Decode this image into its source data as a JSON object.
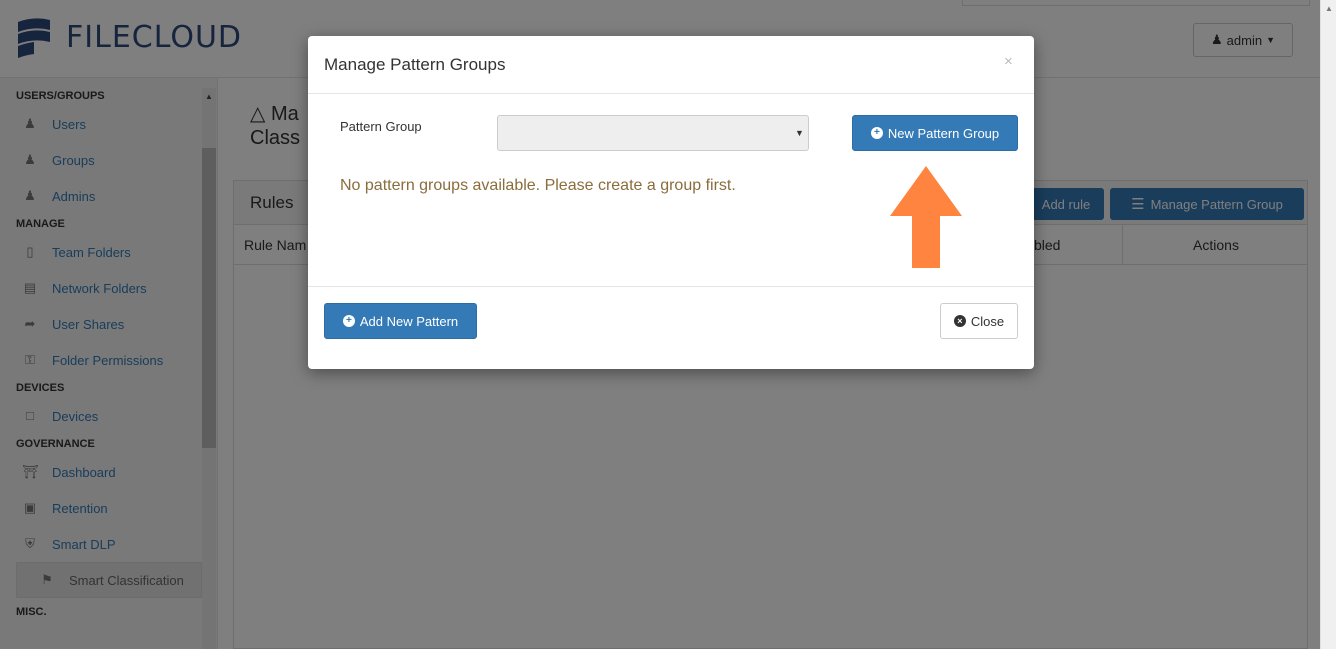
{
  "header": {
    "logo_text": "FILECLOUD",
    "user_menu_label": "admin"
  },
  "sidebar": {
    "sections": [
      {
        "title": "USERS/GROUPS",
        "items": [
          {
            "label": "Users",
            "icon": "user-icon"
          },
          {
            "label": "Groups",
            "icon": "users-icon"
          },
          {
            "label": "Admins",
            "icon": "admin-icon"
          }
        ]
      },
      {
        "title": "MANAGE",
        "items": [
          {
            "label": "Team Folders",
            "icon": "folder-open-icon"
          },
          {
            "label": "Network Folders",
            "icon": "hdd-icon"
          },
          {
            "label": "User Shares",
            "icon": "share-icon"
          },
          {
            "label": "Folder Permissions",
            "icon": "key-icon"
          }
        ]
      },
      {
        "title": "DEVICES",
        "items": [
          {
            "label": "Devices",
            "icon": "device-icon"
          }
        ]
      },
      {
        "title": "GOVERNANCE",
        "items": [
          {
            "label": "Dashboard",
            "icon": "bank-icon"
          },
          {
            "label": "Retention",
            "icon": "archive-icon"
          },
          {
            "label": "Smart DLP",
            "icon": "shield-icon"
          },
          {
            "label": "Smart Classification",
            "icon": "tags-icon"
          }
        ]
      },
      {
        "title": "MISC.",
        "items": []
      }
    ]
  },
  "main": {
    "page_title_line1": "Ma",
    "page_title_line2": "Class",
    "panel_title": "Rules",
    "add_rule_label": "Add rule",
    "manage_pattern_group_label": "Manage Pattern Group",
    "columns": {
      "rule_name": "Rule Nam",
      "enabled": "bled",
      "actions": "Actions"
    }
  },
  "modal": {
    "title": "Manage Pattern Groups",
    "close_x": "×",
    "pattern_group_label": "Pattern Group",
    "pattern_group_value": "",
    "new_group_button": "New Pattern Group",
    "empty_message": "No pattern groups available. Please create a group first.",
    "add_pattern_button": "Add New Pattern",
    "close_button": "Close"
  },
  "colors": {
    "primary": "#337ab7",
    "warning_text": "#8a6d3b",
    "arrow": "#ff8440",
    "logo": "#2c4a7a"
  }
}
